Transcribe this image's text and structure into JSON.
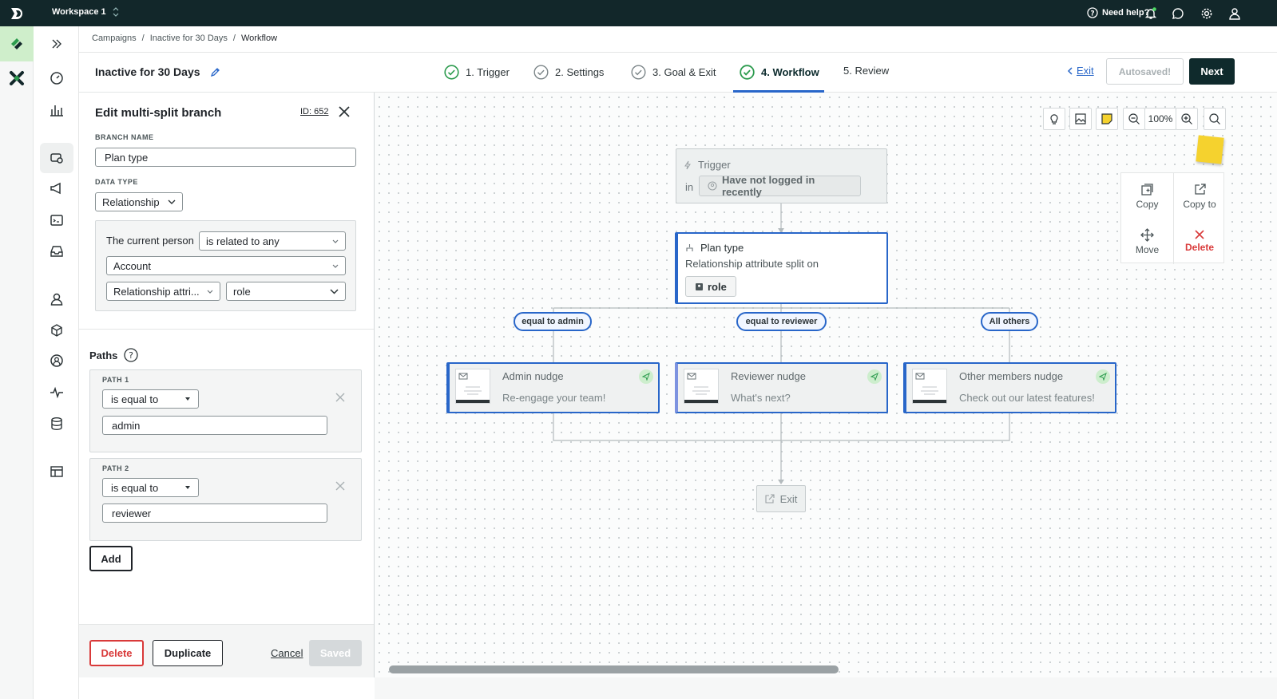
{
  "topbar": {
    "workspace": "Workspace 1",
    "help": "Need help?"
  },
  "breadcrumb": [
    "Campaigns",
    "/",
    "Inactive for 30 Days",
    "/",
    "Workflow"
  ],
  "header": {
    "title": "Inactive for 30 Days",
    "steps": [
      "1. Trigger",
      "2. Settings",
      "3. Goal & Exit",
      "4. Workflow",
      "5. Review"
    ],
    "exit": "Exit",
    "autosaved": "Autosaved!",
    "next": "Next"
  },
  "panel": {
    "title": "Edit multi-split branch",
    "id": "ID: 652",
    "branch_name_label": "BRANCH NAME",
    "branch_name": "Plan type",
    "data_type_label": "DATA TYPE",
    "data_type": "Relationship",
    "current_person": "The current person",
    "relation": "is related to any",
    "object": "Account",
    "attr": "Relationship attri...",
    "attr_value": "role",
    "paths_label": "Paths",
    "paths": [
      {
        "label": "PATH 1",
        "operator": "is equal to",
        "value": "admin"
      },
      {
        "label": "PATH 2",
        "operator": "is equal to",
        "value": "reviewer"
      }
    ],
    "add": "Add",
    "delete": "Delete",
    "duplicate": "Duplicate",
    "cancel": "Cancel",
    "saved": "Saved"
  },
  "canvas": {
    "zoom": "100%",
    "trigger": {
      "title": "Trigger",
      "in": "in",
      "segment": "Have not logged in recently"
    },
    "split": {
      "title": "Plan type",
      "subtitle": "Relationship attribute split on",
      "attr": "role"
    },
    "branches": [
      "equal to admin",
      "equal to reviewer",
      "All others"
    ],
    "messages": [
      {
        "title": "Admin nudge",
        "subtitle": "Re-engage your team!"
      },
      {
        "title": "Reviewer nudge",
        "subtitle": "What's next?"
      },
      {
        "title": "Other members nudge",
        "subtitle": "Check out our latest features!"
      }
    ],
    "exit": "Exit",
    "menu": {
      "copy": "Copy",
      "copy_to": "Copy to",
      "move": "Move",
      "delete": "Delete"
    }
  },
  "colors": {
    "accent": "#2866c9",
    "topbar": "#12272a",
    "danger": "#d93a3a",
    "success": "#2c9b4e"
  }
}
